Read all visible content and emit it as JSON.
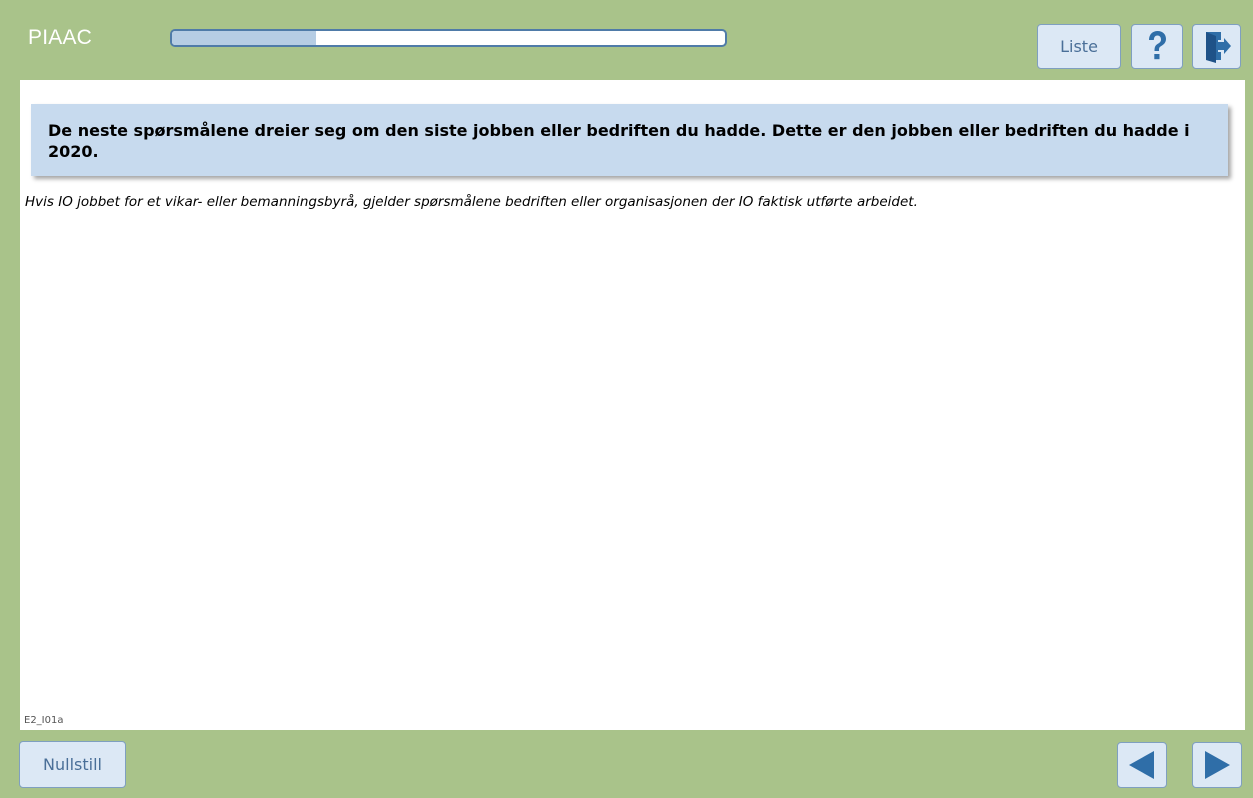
{
  "header": {
    "app_title": "PIAAC",
    "progress": 0.26,
    "liste_label": "Liste",
    "help_icon": "question-mark-icon",
    "exit_icon": "exit-door-icon"
  },
  "main": {
    "question_text": "De neste spørsmålene dreier seg om den siste jobben eller bedriften du hadde. Dette er den jobben eller bedriften du hadde i 2020.",
    "instruction_text": "Hvis IO jobbet for et vikar- eller bemanningsbyrå, gjelder spørsmålene bedriften eller organisasjonen der IO faktisk utførte arbeidet.",
    "screen_id": "E2_I01a"
  },
  "footer": {
    "reset_label": "Nullstill",
    "prev_icon": "arrow-left-icon",
    "next_icon": "arrow-right-icon"
  },
  "colors": {
    "frame_green": "#a9c38a",
    "button_bg": "#dce8f5",
    "icon_blue": "#2f6ea8",
    "question_box": "#c7daee",
    "progress_fill": "#b6cde4",
    "progress_border": "#4f7ba8"
  }
}
